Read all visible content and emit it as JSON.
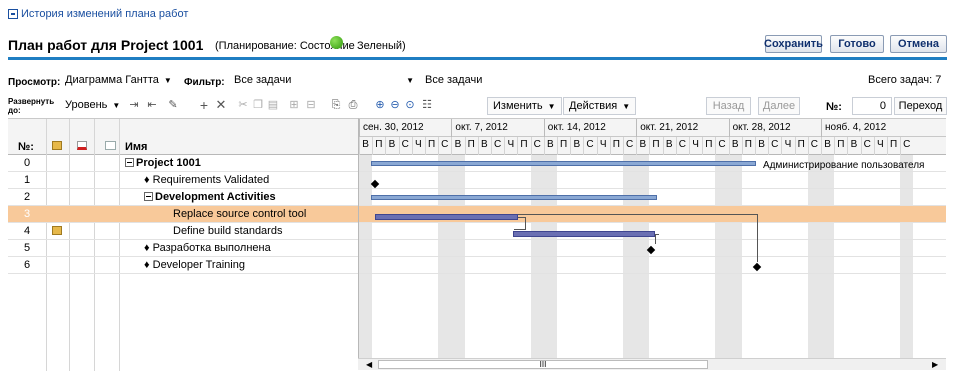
{
  "history_link": "История изменений плана работ",
  "title": "План работ для Project 1001",
  "status_label": "(Планирование: Состояние",
  "status_value": "Зеленый)",
  "status_color": "#3aa50f",
  "buttons": {
    "save": "Сохранить",
    "done": "Готово",
    "cancel": "Отмена"
  },
  "view": {
    "label": "Просмотр:",
    "value": "Диаграмма Гантта"
  },
  "filter": {
    "label": "Фильтр:",
    "value": "Все задачи",
    "value2": "Все задачи"
  },
  "total": "Всего задач: 7",
  "toolbar": {
    "expand_label": "Развернуть до:",
    "level": "Уровень",
    "change": "Изменить",
    "actions": "Действия",
    "back": "Назад",
    "next": "Далее",
    "num_label": "№:",
    "num_value": "0",
    "go": "Переход"
  },
  "grid": {
    "col_num": "№:",
    "col_name": "Имя",
    "rows": [
      {
        "num": "0",
        "name": "Project 1001",
        "marker": "minus"
      },
      {
        "num": "1",
        "name": "Requirements Validated",
        "marker": "diamond"
      },
      {
        "num": "2",
        "name": "Development Activities",
        "marker": "minus"
      },
      {
        "num": "3",
        "name": "Replace source control tool",
        "marker": ""
      },
      {
        "num": "4",
        "name": "Define build standards",
        "marker": ""
      },
      {
        "num": "5",
        "name": "Разработка выполнена",
        "marker": "diamond"
      },
      {
        "num": "6",
        "name": "Developer Training",
        "marker": "diamond"
      }
    ]
  },
  "gantt": {
    "weeks": [
      "сен. 30, 2012",
      "окт. 7, 2012",
      "окт. 14, 2012",
      "окт. 21, 2012",
      "окт. 28, 2012",
      "нояб. 4, 2012"
    ],
    "days": [
      "В",
      "П",
      "В",
      "С",
      "Ч",
      "П",
      "С"
    ],
    "row0_label": "Администрирование пользователя",
    "scroll_mark": "III"
  }
}
